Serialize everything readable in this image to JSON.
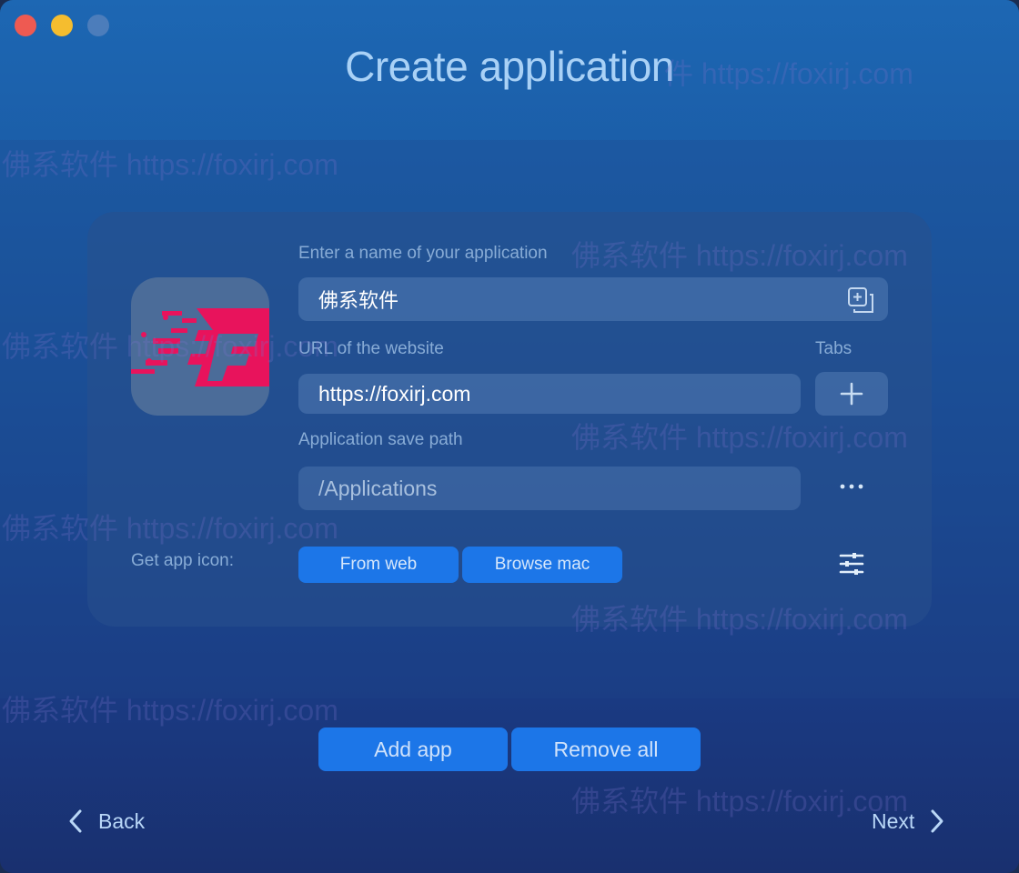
{
  "window": {
    "title": "Create application"
  },
  "form": {
    "name_label": "Enter a name of your application",
    "name_value": "佛系软件",
    "url_label": "URL of the website",
    "url_value": "https://foxirj.com",
    "tabs_label": "Tabs",
    "path_label": "Application save path",
    "path_value": "/Applications",
    "icon_label": "Get app icon:",
    "from_web_label": "From web",
    "browse_mac_label": "Browse mac"
  },
  "actions": {
    "add_app_label": "Add app",
    "remove_all_label": "Remove all"
  },
  "nav": {
    "back_label": "Back",
    "next_label": "Next"
  },
  "watermark": {
    "text": "佛系软件 https://foxirj.com",
    "partial": "件 https://foxirj.com"
  },
  "colors": {
    "accent": "#1c76e8",
    "logo": "#e8135c",
    "close": "#ee5a52",
    "minimize": "#f5bd2f"
  },
  "icons": [
    "copy-plus-icon",
    "plus-icon",
    "ellipsis-icon",
    "sliders-icon",
    "chevron-left-icon",
    "chevron-right-icon",
    "app-logo"
  ]
}
